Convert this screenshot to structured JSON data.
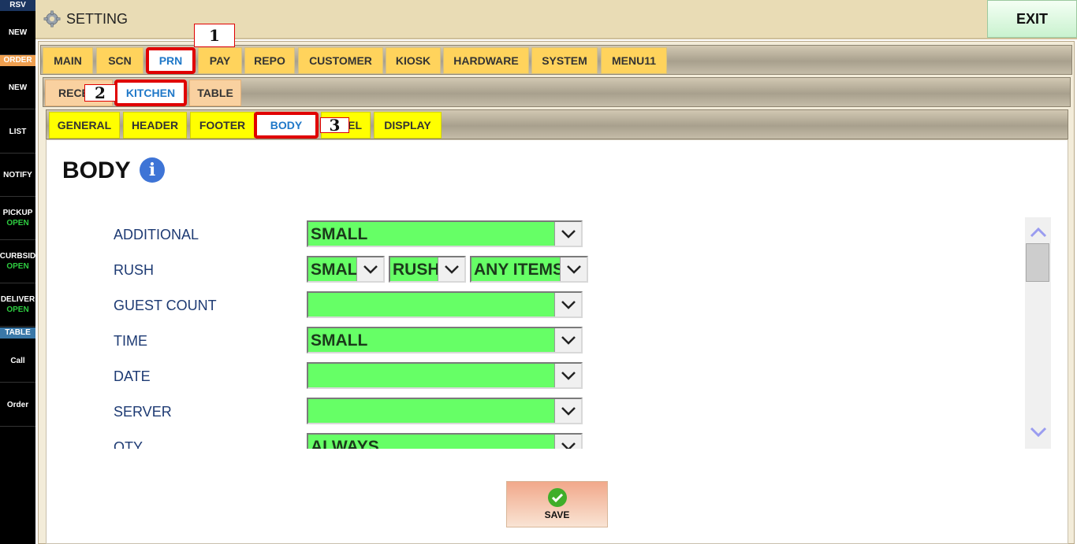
{
  "sidebar": {
    "rsv_header": "RSV",
    "rsv_new": "NEW",
    "order_header": "ORDER",
    "order_new": "NEW",
    "list": "LIST",
    "notify": "NOTIFY",
    "pickup": {
      "label": "PICKUP",
      "status": "OPEN"
    },
    "curbside": {
      "label": "CURBSID",
      "status": "OPEN"
    },
    "delivery": {
      "label": "DELIVER",
      "status": "OPEN"
    },
    "table_header": "TABLE",
    "call": "Call",
    "order": "Order",
    "colors": {
      "order_header": "#f0a050",
      "table_header": "#3a78a8",
      "status": "#2ecc40"
    }
  },
  "topbar": {
    "title": "SETTING",
    "exit_label": "EXIT"
  },
  "tabs_level1": [
    "MAIN",
    "SCN",
    "PRN",
    "PAY",
    "REPO",
    "CUSTOMER",
    "KIOSK",
    "HARDWARE",
    "SYSTEM",
    "MENU11"
  ],
  "tabs_level1_active": "PRN",
  "tabs_level2": [
    "RECE",
    "KITCHEN",
    "TABLE"
  ],
  "tabs_level2_active": "KITCHEN",
  "tabs_level3": [
    "GENERAL",
    "HEADER",
    "FOOTER",
    "BODY",
    "EL",
    "DISPLAY"
  ],
  "tabs_level3_active": "BODY",
  "badges": [
    "1",
    "2",
    "3"
  ],
  "page": {
    "title": "BODY",
    "info_icon": "info-icon"
  },
  "rows": [
    {
      "label": "ADDITIONAL",
      "value": "SMALL"
    },
    {
      "label": "RUSH",
      "values": [
        "SMAL",
        "RUSH",
        "ANY ITEMS"
      ]
    },
    {
      "label": "GUEST COUNT",
      "value": ""
    },
    {
      "label": "TIME",
      "value": "SMALL"
    },
    {
      "label": "DATE",
      "value": ""
    },
    {
      "label": "SERVER",
      "value": ""
    },
    {
      "label": "QTY",
      "value": "ALWAYS"
    }
  ],
  "save_label": "SAVE",
  "colors": {
    "select_bg": "#66ff66",
    "active_tab_border": "#e00000",
    "active_tab_text": "#1f78c8"
  }
}
